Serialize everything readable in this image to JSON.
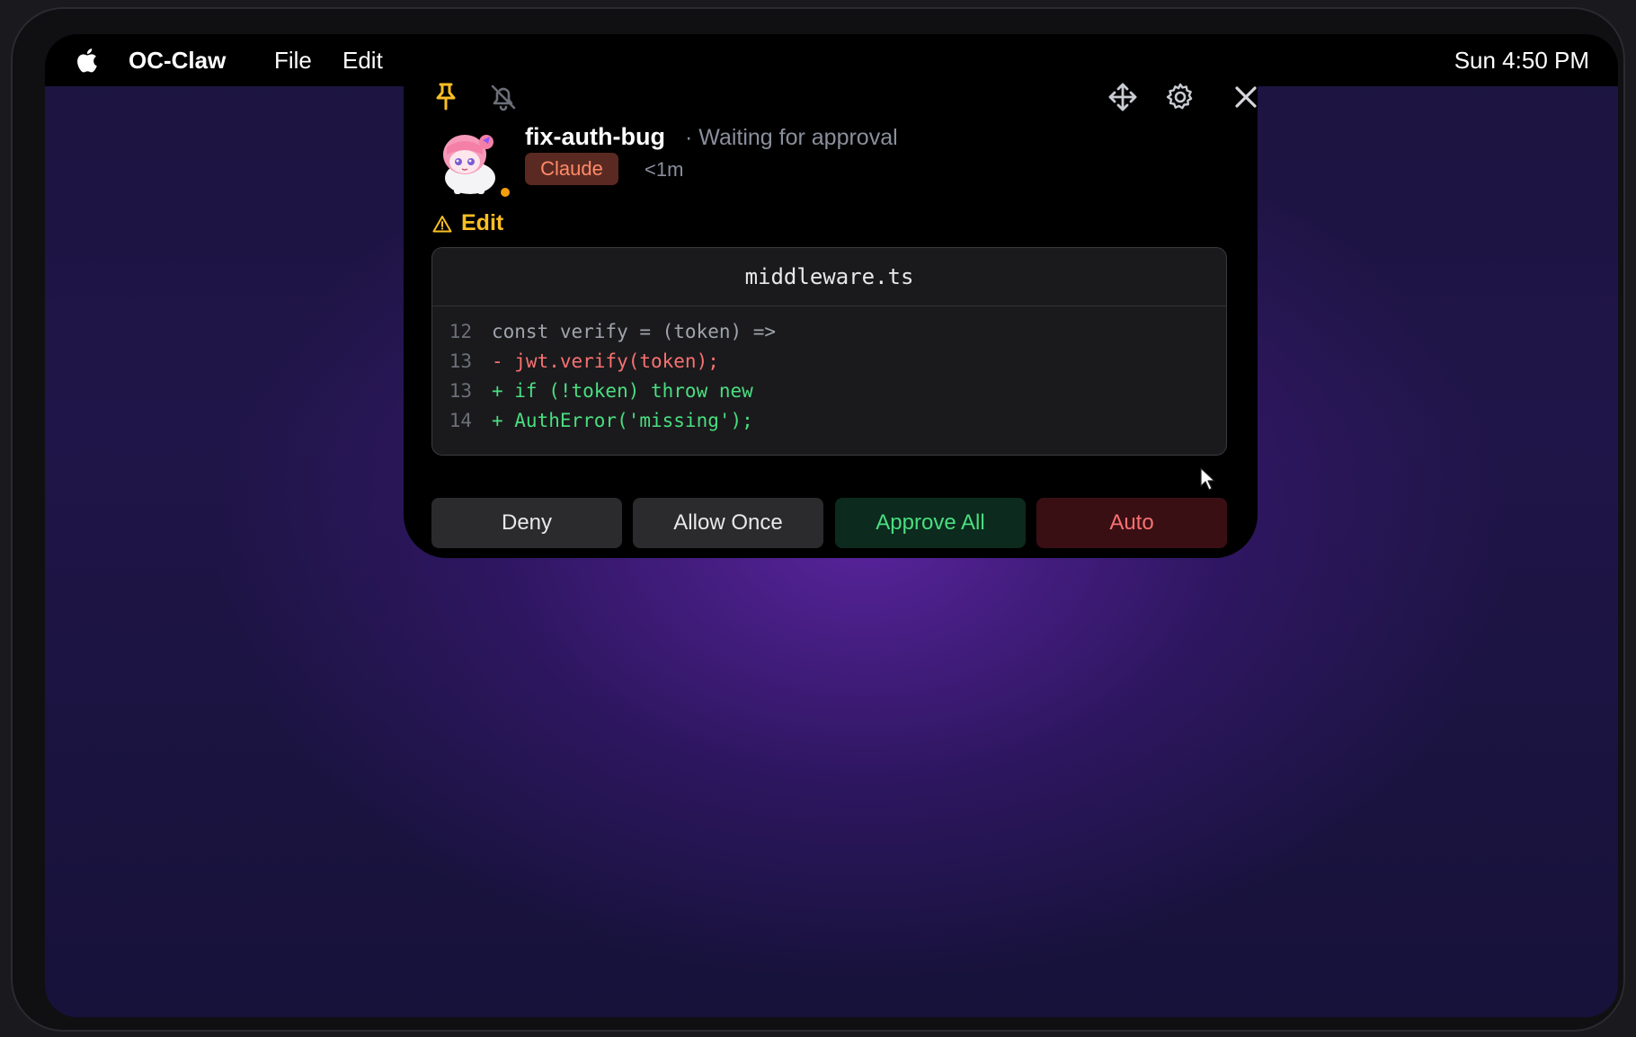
{
  "menubar": {
    "apple_icon": "apple-logo-icon",
    "app_name": "OC-Claw",
    "menus": [
      "File",
      "Edit"
    ],
    "clock": "Sun 4:50 PM"
  },
  "panel": {
    "toolbar_icons": [
      "pin-icon",
      "bell-off-icon",
      "move-icon",
      "gear-icon",
      "close-icon"
    ],
    "session": {
      "name": "fix-auth-bug",
      "status": "· Waiting for approval",
      "agent": "Claude",
      "elapsed": "<1m"
    },
    "tool": {
      "icon": "warning-icon",
      "label": "Edit"
    },
    "diff": {
      "filename": "middleware.ts",
      "lines": [
        {
          "no": "12",
          "code": "const verify = (token) =>",
          "kind": "context"
        },
        {
          "no": "13",
          "code": "- jwt.verify(token);",
          "kind": "removed"
        },
        {
          "no": "13",
          "code": "+ if (!token) throw new",
          "kind": "added"
        },
        {
          "no": "14",
          "code": "+ AuthError('missing');",
          "kind": "added"
        }
      ]
    },
    "actions": {
      "deny": "Deny",
      "allow_once": "Allow Once",
      "approve_all": "Approve All",
      "auto": "Auto"
    }
  },
  "colors": {
    "accent_warning": "#fbbf24",
    "pin_active": "#fbbf24",
    "added": "#4ade80",
    "removed": "#f87171",
    "agent_badge": "#ff8a6a",
    "status_dot": "#f59e0b"
  }
}
